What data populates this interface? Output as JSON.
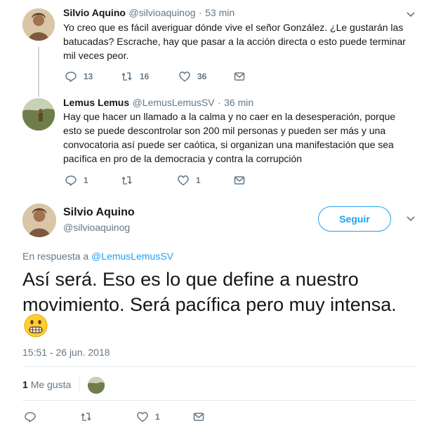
{
  "tweet1": {
    "name": "Silvio Aquino",
    "handle": "@silvioaquinog",
    "time": "53 min",
    "text_lines": [
      "Yo creo que es fácil averiguar dónde vive el señor González. ¿Le gustarán las",
      "batucadas? Escrache, hay que pasar a la acción directa o esto puede terminar",
      "mil veces peor."
    ],
    "replies": "13",
    "retweets": "16",
    "likes": "36"
  },
  "tweet2": {
    "name": "Lemus Lemus",
    "handle": "@LemusLemusSV",
    "time": "36 min",
    "text_lines": [
      "Hay que hacer un llamado a la calma y no caer en la desesperación, porque",
      "esto se puede descontrolar son 200 mil personas y pueden ser más y una",
      "convocatoria así puede ser caótica, si organizan una manifestación que sea",
      "pacífica en pro de la democracia y contra la corrupción"
    ],
    "replies": "1",
    "likes": "1"
  },
  "main_tweet": {
    "name": "Silvio Aquino",
    "handle": "@silvioaquinog",
    "follow_label": "Seguir",
    "reply_prefix": "En respuesta a",
    "reply_mention": "@LemusLemusSV",
    "text_lines": [
      "Así será. Eso es lo que define a nuestro",
      "movimiento. Será pacífica pero muy intensa."
    ],
    "timestamp": "15:51 - 26 jun. 2018",
    "like_count": "1",
    "like_label": "Me gusta",
    "action_likes": "1"
  },
  "icons": [
    "chevron-down-icon",
    "reply-icon",
    "retweet-icon",
    "heart-icon",
    "mail-icon",
    "grimacing-emoji"
  ],
  "colors": {
    "accent": "#1da1f2",
    "secondary_text": "#657786",
    "divider": "#e6ecf0"
  }
}
